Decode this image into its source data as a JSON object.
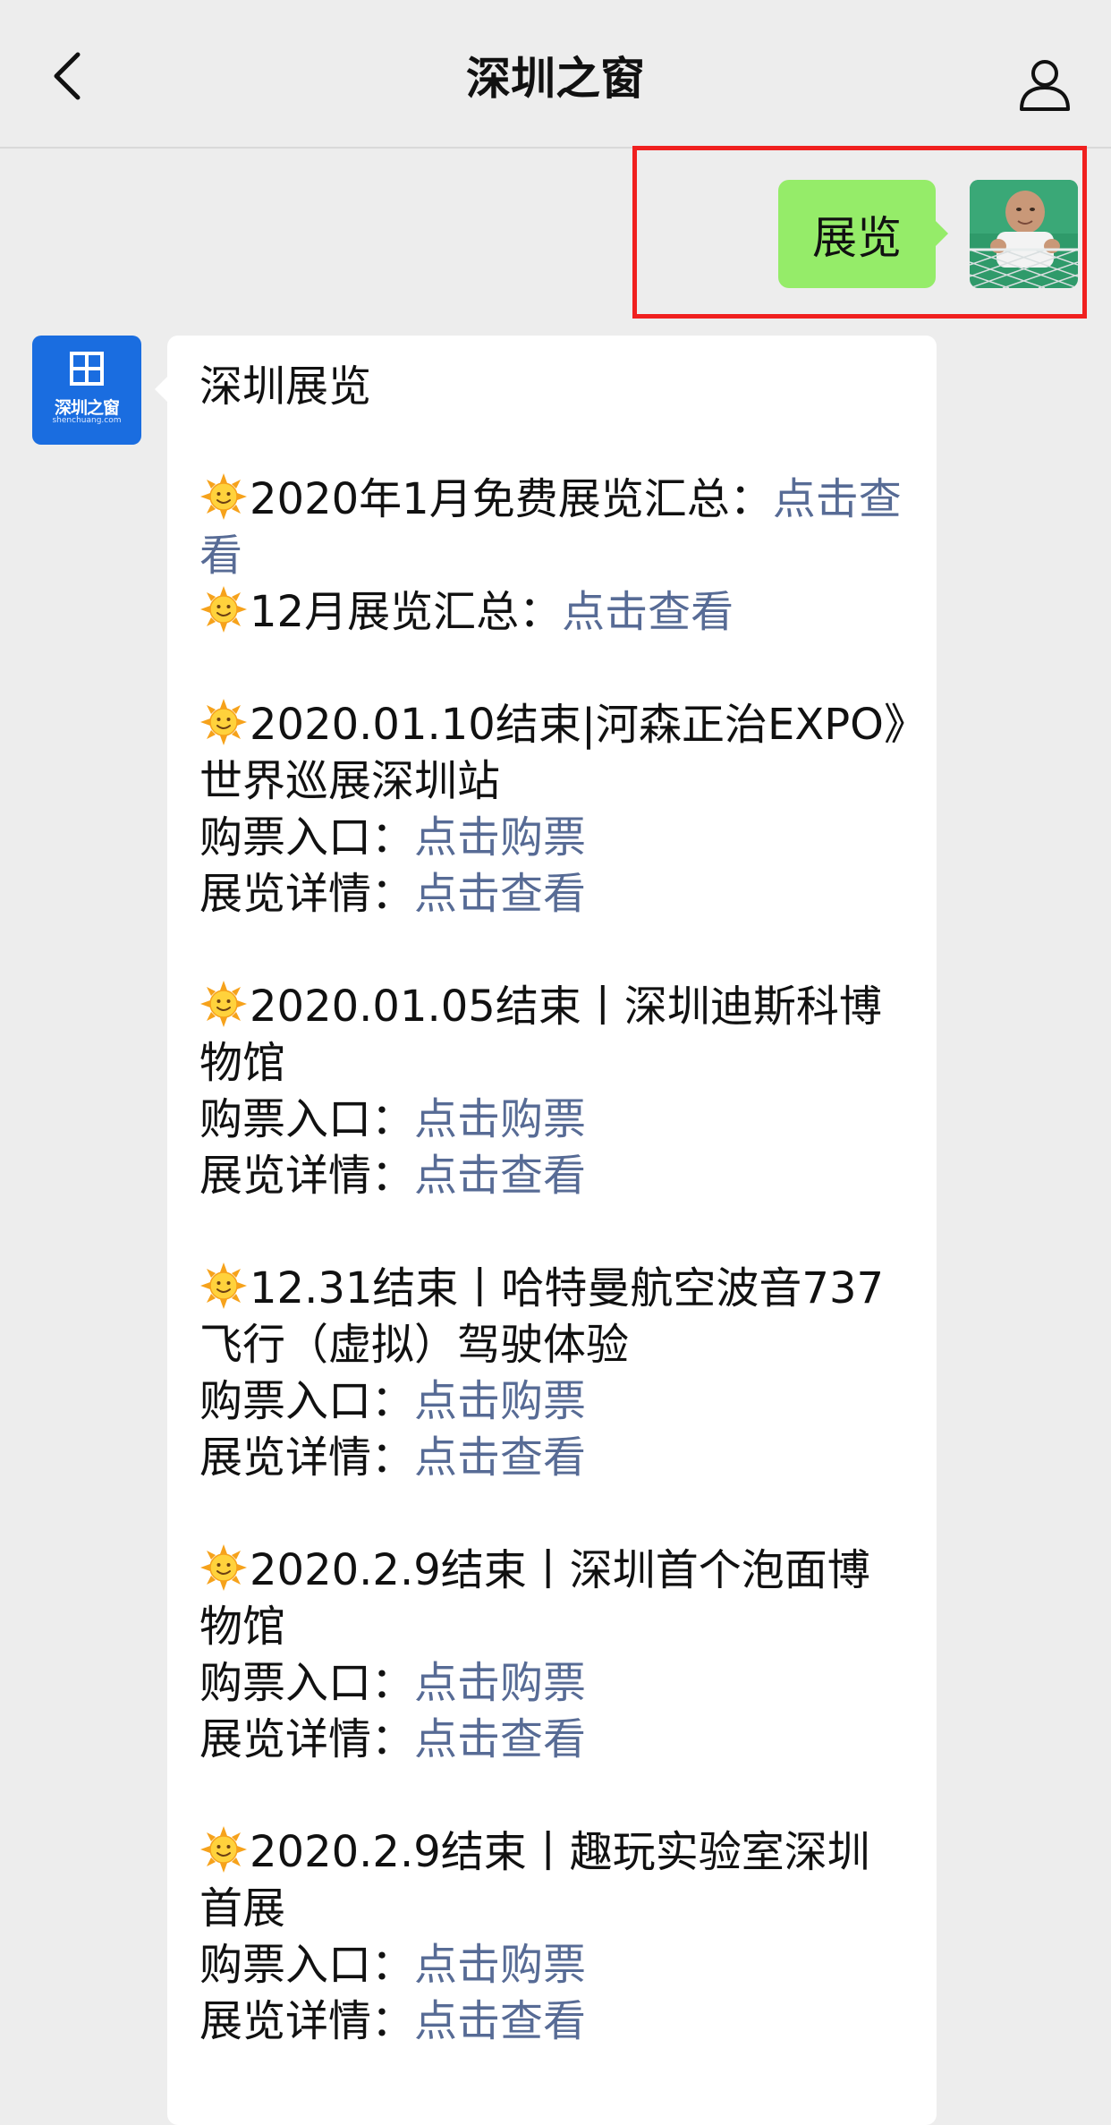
{
  "header": {
    "title": "深圳之窗"
  },
  "user_message": {
    "text": "展览"
  },
  "bot": {
    "logo_text": "深圳之窗",
    "logo_sub": "shenchuang.com"
  },
  "message": {
    "heading": "深圳展览",
    "summary": [
      {
        "label": "2020年1月免费展览汇总：",
        "link": "点击查看"
      },
      {
        "label": "12月展览汇总：",
        "link": "点击查看"
      }
    ],
    "exhibitions": [
      {
        "title": "2020.01.10结束|河森正治EXPO》世界巡展深圳站",
        "ticket_label": "购票入口：",
        "ticket_link": "点击购票",
        "detail_label": "展览详情：",
        "detail_link": "点击查看"
      },
      {
        "title": "2020.01.05结束丨深圳迪斯科博物馆",
        "ticket_label": "购票入口：",
        "ticket_link": "点击购票",
        "detail_label": "展览详情：",
        "detail_link": "点击查看"
      },
      {
        "title": "12.31结束丨哈特曼航空波音737飞行（虚拟）驾驶体验",
        "ticket_label": "购票入口：",
        "ticket_link": "点击购票",
        "detail_label": "展览详情：",
        "detail_link": "点击查看"
      },
      {
        "title": "2020.2.9结束丨深圳首个泡面博物馆",
        "ticket_label": "购票入口：",
        "ticket_link": "点击购票",
        "detail_label": "展览详情：",
        "detail_link": "点击查看"
      },
      {
        "title": "2020.2.9结束丨趣玩实验室深圳首展",
        "ticket_label": "购票入口：",
        "ticket_link": "点击购票",
        "detail_label": "展览详情：",
        "detail_link": "点击查看"
      }
    ]
  },
  "icons": {
    "back": "chevron-left-icon",
    "profile": "person-icon",
    "bullet": "sun-icon"
  },
  "colors": {
    "background": "#ededed",
    "user_bubble": "#95ec69",
    "link": "#576b95",
    "highlight": "#f0201f",
    "logo_blue": "#1a6de0"
  }
}
